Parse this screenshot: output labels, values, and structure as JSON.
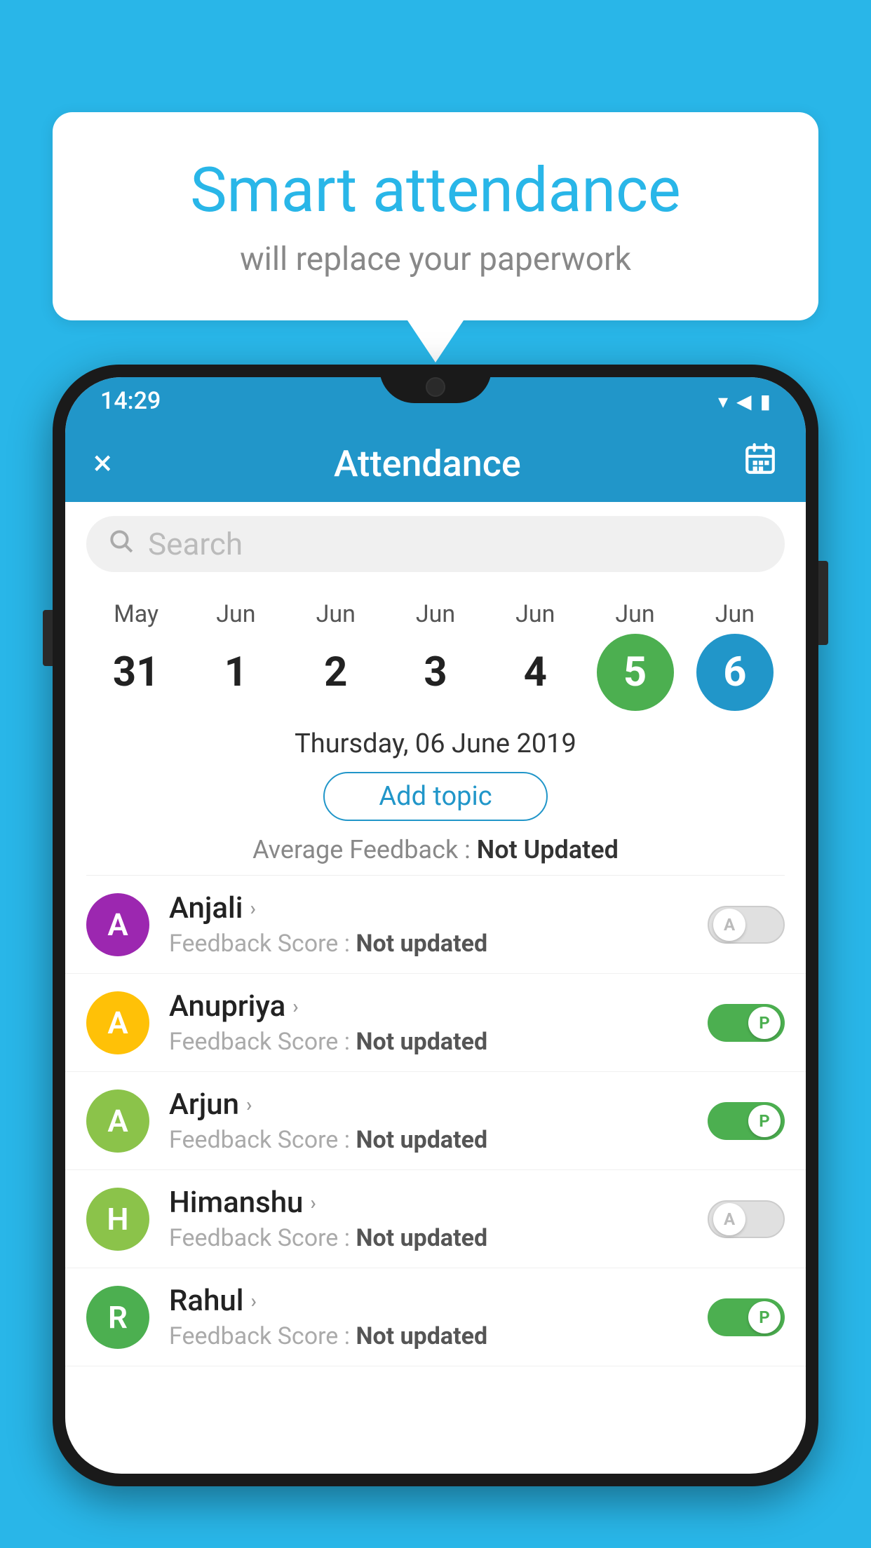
{
  "background_color": "#29b6e8",
  "speech_bubble": {
    "title": "Smart attendance",
    "subtitle": "will replace your paperwork"
  },
  "status_bar": {
    "time": "14:29",
    "icons": [
      "wifi",
      "signal",
      "battery"
    ]
  },
  "app_bar": {
    "title": "Attendance",
    "close_label": "×",
    "calendar_icon": "calendar"
  },
  "search": {
    "placeholder": "Search"
  },
  "calendar": {
    "days": [
      {
        "month": "May",
        "day": "31",
        "state": "normal"
      },
      {
        "month": "Jun",
        "day": "1",
        "state": "normal"
      },
      {
        "month": "Jun",
        "day": "2",
        "state": "normal"
      },
      {
        "month": "Jun",
        "day": "3",
        "state": "normal"
      },
      {
        "month": "Jun",
        "day": "4",
        "state": "normal"
      },
      {
        "month": "Jun",
        "day": "5",
        "state": "today"
      },
      {
        "month": "Jun",
        "day": "6",
        "state": "selected"
      }
    ]
  },
  "selected_date_label": "Thursday, 06 June 2019",
  "add_topic_label": "Add topic",
  "average_feedback": {
    "label": "Average Feedback :",
    "value": "Not Updated"
  },
  "students": [
    {
      "name": "Anjali",
      "avatar_letter": "A",
      "avatar_color": "#9c27b0",
      "feedback_label": "Feedback Score :",
      "feedback_value": "Not updated",
      "toggle_state": "off",
      "toggle_label": "A"
    },
    {
      "name": "Anupriya",
      "avatar_letter": "A",
      "avatar_color": "#ffc107",
      "feedback_label": "Feedback Score :",
      "feedback_value": "Not updated",
      "toggle_state": "on",
      "toggle_label": "P"
    },
    {
      "name": "Arjun",
      "avatar_letter": "A",
      "avatar_color": "#8bc34a",
      "feedback_label": "Feedback Score :",
      "feedback_value": "Not updated",
      "toggle_state": "on",
      "toggle_label": "P"
    },
    {
      "name": "Himanshu",
      "avatar_letter": "H",
      "avatar_color": "#8bc34a",
      "feedback_label": "Feedback Score :",
      "feedback_value": "Not updated",
      "toggle_state": "off",
      "toggle_label": "A"
    },
    {
      "name": "Rahul",
      "avatar_letter": "R",
      "avatar_color": "#4caf50",
      "feedback_label": "Feedback Score :",
      "feedback_value": "Not updated",
      "toggle_state": "on",
      "toggle_label": "P"
    }
  ]
}
